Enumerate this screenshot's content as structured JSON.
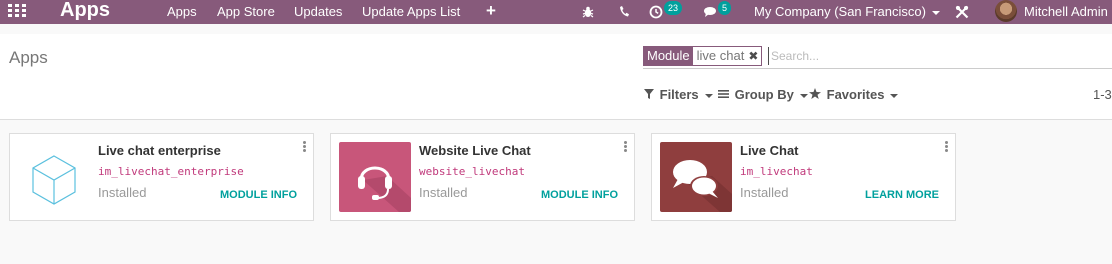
{
  "navbar": {
    "brand": "Apps",
    "menu": [
      "Apps",
      "App Store",
      "Updates",
      "Update Apps List"
    ],
    "plus_icon": "plus-icon",
    "activity_count": "23",
    "messages_count": "5",
    "company": "My Company (San Francisco)",
    "user": "Mitchell Admin",
    "colors": {
      "navbar": "#875a7b",
      "badge": "#00a09d"
    }
  },
  "control_panel": {
    "title": "Apps",
    "search": {
      "facet_label": "Module",
      "facet_value": "live chat",
      "placeholder": "Search..."
    },
    "filters_label": "Filters",
    "group_by_label": "Group By",
    "favorites_label": "Favorites",
    "pager": "1-3"
  },
  "cards": [
    {
      "name": "Live chat enterprise",
      "technical_name": "im_livechat_enterprise",
      "state": "Installed",
      "action": "MODULE INFO",
      "icon": "cube-icon"
    },
    {
      "name": "Website Live Chat",
      "technical_name": "website_livechat",
      "state": "Installed",
      "action": "MODULE INFO",
      "icon": "headset-icon"
    },
    {
      "name": "Live Chat",
      "technical_name": "im_livechat",
      "state": "Installed",
      "action": "LEARN MORE",
      "icon": "chat-bubbles-icon"
    }
  ]
}
